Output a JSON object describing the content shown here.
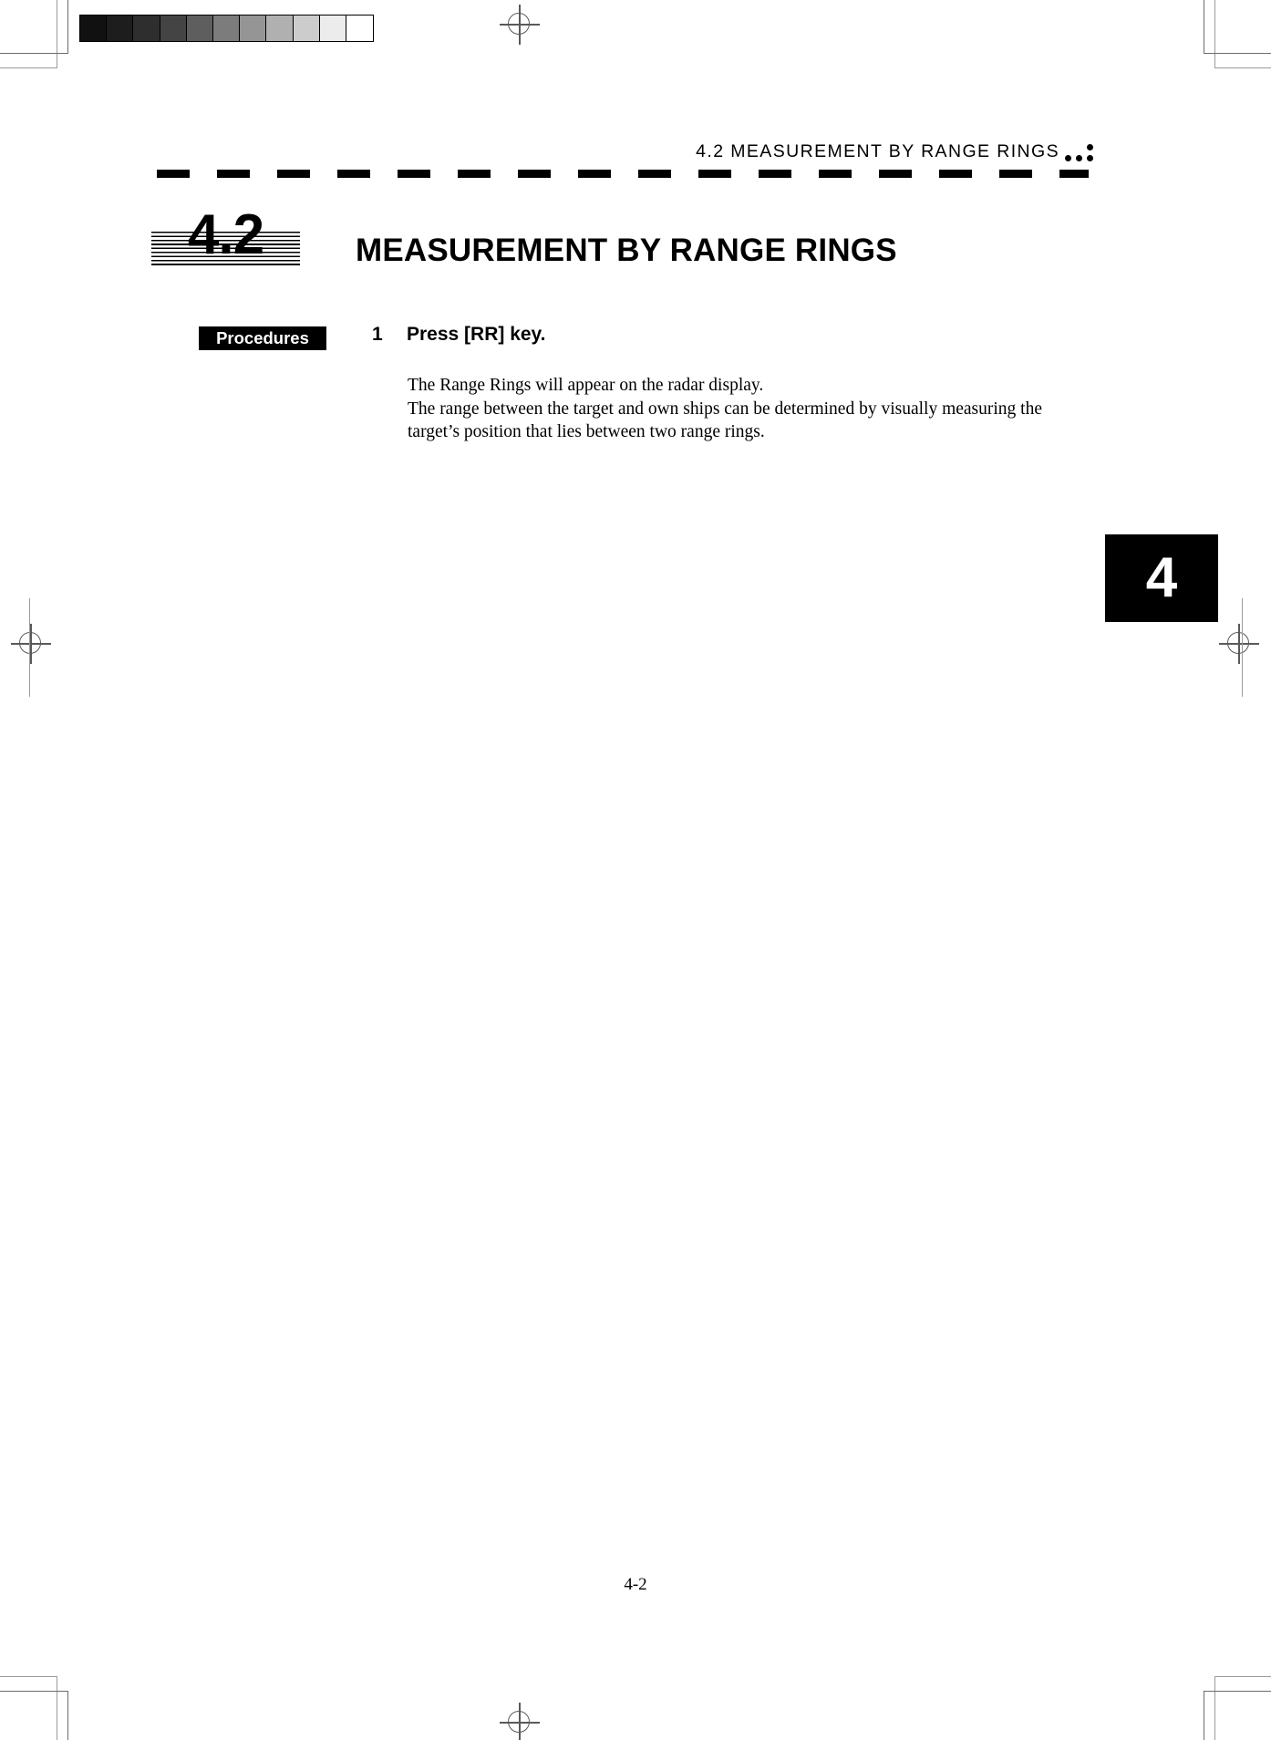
{
  "page": {
    "running_header": "4.2   MEASUREMENT  BY  RANGE  RINGS",
    "page_number": "4-2",
    "chapter_tab": "4"
  },
  "section": {
    "number": "4.2",
    "title": "MEASUREMENT BY RANGE RINGS"
  },
  "procedures": {
    "label": "Procedures",
    "steps": [
      {
        "number": "1",
        "heading": "Press [RR] key.",
        "body_lines": [
          "The Range Rings will appear on the radar display.",
          "The range between the target and own ships can be determined by visually measuring the",
          "target’s position that lies between two range rings."
        ]
      }
    ]
  },
  "calibration_strip": {
    "name": "grayscale-step-wedge",
    "swatches": [
      "#111111",
      "#1d1d1d",
      "#2e2e2e",
      "#444444",
      "#5e5e5e",
      "#7c7c7c",
      "#959595",
      "#b0b0b0",
      "#cccccc",
      "#ececec",
      "#ffffff"
    ]
  },
  "colors": {
    "ink": "#000000",
    "paper": "#ffffff",
    "crop_mark": "#9a9a9a",
    "registration_mark": "#595959"
  }
}
